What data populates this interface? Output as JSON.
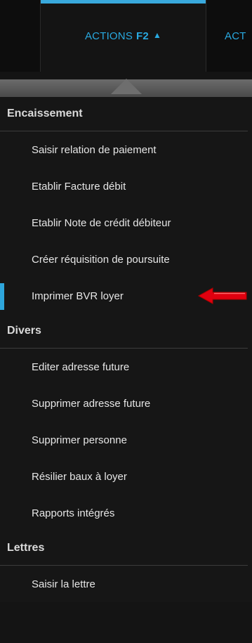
{
  "tabs": {
    "actions": {
      "label": "ACTIONS",
      "key": "F2",
      "caret": "▲"
    },
    "next_label": "ACT"
  },
  "menu": {
    "sections": [
      {
        "title": "Encaissement",
        "items": [
          "Saisir relation de paiement",
          "Etablir Facture débit",
          "Etablir Note de crédit débiteur",
          "Créer réquisition de poursuite",
          "Imprimer BVR loyer"
        ]
      },
      {
        "title": "Divers",
        "items": [
          "Editer adresse future",
          "Supprimer adresse future",
          "Supprimer personne",
          "Résilier baux à loyer",
          "Rapports intégrés"
        ]
      },
      {
        "title": "Lettres",
        "items": [
          "Saisir la lettre"
        ]
      }
    ],
    "selected_item": "Imprimer BVR loyer"
  },
  "colors": {
    "accent": "#39a9dd",
    "annotation_arrow": "#e0000f"
  }
}
